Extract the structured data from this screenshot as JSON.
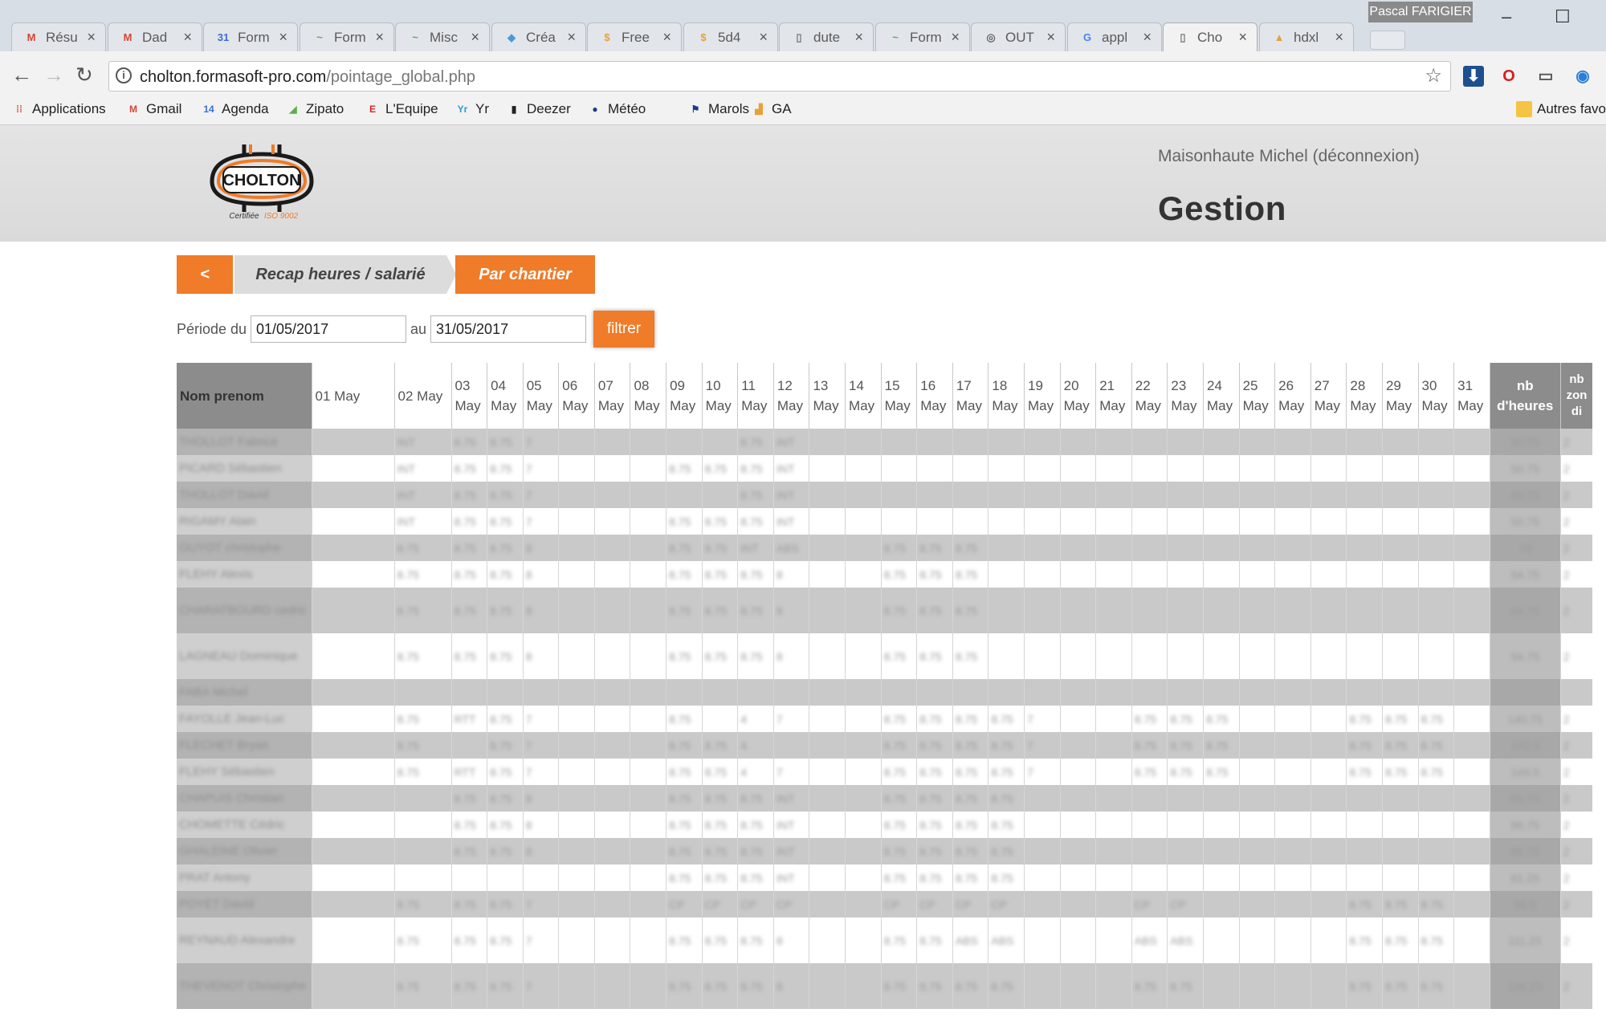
{
  "browser": {
    "profile_name": "Pascal FARIGIER",
    "tabs": [
      {
        "title": "Résu",
        "icon": "gmail-icon",
        "color": "#d44638",
        "glyph": "M",
        "active": false
      },
      {
        "title": "Dad",
        "icon": "gmail-icon",
        "color": "#d44638",
        "glyph": "M",
        "active": false
      },
      {
        "title": "Form",
        "icon": "calendar-icon",
        "color": "#3b6fd1",
        "glyph": "31",
        "active": false
      },
      {
        "title": "Form",
        "icon": "zipato-icon",
        "color": "#5ab04a",
        "glyph": "~",
        "active": false
      },
      {
        "title": "Misc",
        "icon": "zipato-icon",
        "color": "#5ab04a",
        "glyph": "~",
        "active": false
      },
      {
        "title": "Créa",
        "icon": "diamond-icon",
        "color": "#4a9ad8",
        "glyph": "◆",
        "active": false
      },
      {
        "title": "Free",
        "icon": "coin-icon",
        "color": "#e8a03a",
        "glyph": "$",
        "active": false
      },
      {
        "title": "5d4",
        "icon": "coin-icon",
        "color": "#e8a03a",
        "glyph": "$",
        "active": false
      },
      {
        "title": "dute",
        "icon": "page-icon",
        "color": "#777777",
        "glyph": "▯",
        "active": false
      },
      {
        "title": "Form",
        "icon": "zipato-icon",
        "color": "#5ab04a",
        "glyph": "~",
        "active": false
      },
      {
        "title": "OUT",
        "icon": "circle-icon",
        "color": "#666666",
        "glyph": "◎",
        "active": false
      },
      {
        "title": "appl",
        "icon": "google-icon",
        "color": "#4285f4",
        "glyph": "G",
        "active": false
      },
      {
        "title": "Cho",
        "icon": "page-icon",
        "color": "#777777",
        "glyph": "▯",
        "active": true
      },
      {
        "title": "hdxl",
        "icon": "pma-icon",
        "color": "#e8a03a",
        "glyph": "▲",
        "active": false
      }
    ],
    "url_host": "cholton.formasoft-pro.com",
    "url_path": "/pointage_global.php",
    "bookmarks": [
      {
        "label": "Applications",
        "icon": "apps-grid-icon",
        "color": "#e0533c",
        "glyph": "⁞⁞"
      },
      {
        "label": "Gmail",
        "icon": "gmail-icon",
        "color": "#d44638",
        "glyph": "M"
      },
      {
        "label": "Agenda",
        "icon": "calendar-icon",
        "color": "#3b6fd1",
        "glyph": "14"
      },
      {
        "label": "Zipato",
        "icon": "zipato-icon",
        "color": "#5ab04a",
        "glyph": "◢"
      },
      {
        "label": "L'Equipe",
        "icon": "lequipe-icon",
        "color": "#d02a2a",
        "glyph": "E"
      },
      {
        "label": "Yr",
        "icon": "yr-icon",
        "color": "#2a9ad8",
        "glyph": "Yr"
      },
      {
        "label": "Deezer",
        "icon": "deezer-icon",
        "color": "#222222",
        "glyph": "▮"
      },
      {
        "label": "Météo",
        "icon": "meteo-icon",
        "color": "#1a3a8a",
        "glyph": "●"
      },
      {
        "label": "Marols",
        "icon": "marols-icon",
        "color": "#1a3a8a",
        "glyph": "⚑"
      },
      {
        "label": "GA",
        "icon": "analytics-icon",
        "color": "#e8a03a",
        "glyph": "▟"
      }
    ],
    "other_bookmarks": "Autres favoris"
  },
  "header": {
    "logo_text": "CHOLTON",
    "logo_tagline": "Certifiée",
    "logo_iso": "ISO 9002",
    "user": "Maisonhaute Michel (déconnexion)",
    "title": "Gestion",
    "brand_color": "#f07b28"
  },
  "subnav": {
    "back": "<",
    "recap": "Recap heures / salarié",
    "chantier": "Par chantier"
  },
  "filter": {
    "label": "Période du",
    "from": "01/05/2017",
    "to_label": "au",
    "to": "31/05/2017",
    "button": "filtrer"
  },
  "table": {
    "name_header": "Nom prenom",
    "days": [
      {
        "num": "01",
        "mon": "May",
        "inline": true
      },
      {
        "num": "02",
        "mon": "May",
        "inline": true
      },
      {
        "num": "03",
        "mon": "May"
      },
      {
        "num": "04",
        "mon": "May"
      },
      {
        "num": "05",
        "mon": "May"
      },
      {
        "num": "06",
        "mon": "May"
      },
      {
        "num": "07",
        "mon": "May"
      },
      {
        "num": "08",
        "mon": "May"
      },
      {
        "num": "09",
        "mon": "May"
      },
      {
        "num": "10",
        "mon": "May"
      },
      {
        "num": "11",
        "mon": "May"
      },
      {
        "num": "12",
        "mon": "May"
      },
      {
        "num": "13",
        "mon": "May"
      },
      {
        "num": "14",
        "mon": "May"
      },
      {
        "num": "15",
        "mon": "May"
      },
      {
        "num": "16",
        "mon": "May"
      },
      {
        "num": "17",
        "mon": "May"
      },
      {
        "num": "18",
        "mon": "May"
      },
      {
        "num": "19",
        "mon": "May"
      },
      {
        "num": "20",
        "mon": "May"
      },
      {
        "num": "21",
        "mon": "May"
      },
      {
        "num": "22",
        "mon": "May"
      },
      {
        "num": "23",
        "mon": "May"
      },
      {
        "num": "24",
        "mon": "May"
      },
      {
        "num": "25",
        "mon": "May"
      },
      {
        "num": "26",
        "mon": "May"
      },
      {
        "num": "27",
        "mon": "May"
      },
      {
        "num": "28",
        "mon": "May"
      },
      {
        "num": "29",
        "mon": "May"
      },
      {
        "num": "30",
        "mon": "May"
      },
      {
        "num": "31",
        "mon": "May"
      }
    ],
    "total_header": [
      "nb",
      "d'heures"
    ],
    "extra_header": [
      "nb",
      "zon",
      "di"
    ],
    "rows": [
      {
        "name": "THOLLOT Fabrice",
        "cells": [
          "",
          "INT",
          "8.75",
          "8.75",
          "7",
          "",
          "",
          "",
          "",
          "",
          "8.75",
          "INT",
          "",
          "",
          "",
          "",
          "",
          "",
          "",
          "",
          "",
          "",
          "",
          "",
          "",
          "",
          "",
          "",
          "",
          "",
          ""
        ],
        "total": "50.75",
        "extra": "2",
        "tall": false
      },
      {
        "name": "PICARD Sébastien",
        "cells": [
          "",
          "INT",
          "8.75",
          "8.75",
          "7",
          "",
          "",
          "",
          "8.75",
          "8.75",
          "8.75",
          "INT",
          "",
          "",
          "",
          "",
          "",
          "",
          "",
          "",
          "",
          "",
          "",
          "",
          "",
          "",
          "",
          "",
          "",
          "",
          ""
        ],
        "total": "50.75",
        "extra": "2",
        "tall": false
      },
      {
        "name": "THOLLOT David",
        "cells": [
          "",
          "INT",
          "8.75",
          "8.75",
          "7",
          "",
          "",
          "",
          "",
          "",
          "8.75",
          "INT",
          "",
          "",
          "",
          "",
          "",
          "",
          "",
          "",
          "",
          "",
          "",
          "",
          "",
          "",
          "",
          "",
          "",
          "",
          ""
        ],
        "total": "50.75",
        "extra": "2",
        "tall": false
      },
      {
        "name": "RIGAMY Alain",
        "cells": [
          "",
          "INT",
          "8.75",
          "8.75",
          "7",
          "",
          "",
          "",
          "8.75",
          "8.75",
          "8.75",
          "INT",
          "",
          "",
          "",
          "",
          "",
          "",
          "",
          "",
          "",
          "",
          "",
          "",
          "",
          "",
          "",
          "",
          "",
          "",
          ""
        ],
        "total": "50.75",
        "extra": "2",
        "tall": false
      },
      {
        "name": "GUYOT christophe",
        "cells": [
          "",
          "8.75",
          "8.75",
          "8.75",
          "8",
          "",
          "",
          "",
          "8.75",
          "8.75",
          "INT",
          "ABS",
          "",
          "",
          "8.75",
          "8.75",
          "8.75",
          "",
          "",
          "",
          "",
          "",
          "",
          "",
          "",
          "",
          "",
          "",
          "",
          "",
          ""
        ],
        "total": "78",
        "extra": "2",
        "tall": false
      },
      {
        "name": "FLEHY Alexis",
        "cells": [
          "",
          "8.75",
          "8.75",
          "8.75",
          "8",
          "",
          "",
          "",
          "8.75",
          "8.75",
          "8.75",
          "8",
          "",
          "",
          "8.75",
          "8.75",
          "8.75",
          "",
          "",
          "",
          "",
          "",
          "",
          "",
          "",
          "",
          "",
          "",
          "",
          "",
          ""
        ],
        "total": "94.75",
        "extra": "2",
        "tall": false
      },
      {
        "name": "CHARATBOURD cedric",
        "cells": [
          "",
          "8.75",
          "8.75",
          "8.75",
          "8",
          "",
          "",
          "",
          "8.75",
          "8.75",
          "8.75",
          "8",
          "",
          "",
          "8.75",
          "8.75",
          "8.75",
          "",
          "",
          "",
          "",
          "",
          "",
          "",
          "",
          "",
          "",
          "",
          "",
          "",
          ""
        ],
        "total": "94.75",
        "extra": "2",
        "tall": true
      },
      {
        "name": "LAGNEAU Dominique",
        "cells": [
          "",
          "8.75",
          "8.75",
          "8.75",
          "8",
          "",
          "",
          "",
          "8.75",
          "8.75",
          "8.75",
          "8",
          "",
          "",
          "8.75",
          "8.75",
          "8.75",
          "",
          "",
          "",
          "",
          "",
          "",
          "",
          "",
          "",
          "",
          "",
          "",
          "",
          ""
        ],
        "total": "94.75",
        "extra": "2",
        "tall": true
      },
      {
        "name": "FABA Michel",
        "cells": [
          "",
          "",
          "",
          "",
          "",
          "",
          "",
          "",
          "",
          "",
          "",
          "",
          "",
          "",
          "",
          "",
          "",
          "",
          "",
          "",
          "",
          "",
          "",
          "",
          "",
          "",
          "",
          "",
          "",
          "",
          ""
        ],
        "total": "",
        "extra": "",
        "tall": false
      },
      {
        "name": "FAYOLLE Jean-Luc",
        "cells": [
          "",
          "8.75",
          "RTT",
          "8.75",
          "7",
          "",
          "",
          "",
          "8.75",
          "",
          "4",
          "7",
          "",
          "",
          "8.75",
          "8.75",
          "8.75",
          "8.75",
          "7",
          "",
          "",
          "8.75",
          "8.75",
          "8.75",
          "",
          "",
          "",
          "8.75",
          "8.75",
          "8.75",
          ""
        ],
        "total": "140.75",
        "extra": "2",
        "tall": false
      },
      {
        "name": "FLECHET Bryan",
        "cells": [
          "",
          "8.75",
          "",
          "8.75",
          "7",
          "",
          "",
          "",
          "8.75",
          "8.75",
          "4",
          "",
          "",
          "",
          "8.75",
          "8.75",
          "8.75",
          "8.75",
          "7",
          "",
          "",
          "8.75",
          "8.75",
          "8.75",
          "",
          "",
          "",
          "8.75",
          "8.75",
          "8.75",
          ""
        ],
        "total": "142.5",
        "extra": "2",
        "tall": false
      },
      {
        "name": "FLEHY Sébastien",
        "cells": [
          "",
          "8.75",
          "RTT",
          "8.75",
          "7",
          "",
          "",
          "",
          "8.75",
          "8.75",
          "4",
          "7",
          "",
          "",
          "8.75",
          "8.75",
          "8.75",
          "8.75",
          "7",
          "",
          "",
          "8.75",
          "8.75",
          "8.75",
          "",
          "",
          "",
          "8.75",
          "8.75",
          "8.75",
          ""
        ],
        "total": "149.5",
        "extra": "2",
        "tall": false
      },
      {
        "name": "CHAPUIS Christian",
        "cells": [
          "",
          "",
          "8.75",
          "8.75",
          "8",
          "",
          "",
          "",
          "8.75",
          "8.75",
          "8.75",
          "INT",
          "",
          "",
          "8.75",
          "8.75",
          "8.75",
          "8.75",
          "",
          "",
          "",
          "",
          "",
          "",
          "",
          "",
          "",
          "",
          "",
          "",
          ""
        ],
        "total": "86.75",
        "extra": "2",
        "tall": false
      },
      {
        "name": "CHOMETTE Cédric",
        "cells": [
          "",
          "",
          "8.75",
          "8.75",
          "8",
          "",
          "",
          "",
          "8.75",
          "8.75",
          "8.75",
          "INT",
          "",
          "",
          "8.75",
          "8.75",
          "8.75",
          "8.75",
          "",
          "",
          "",
          "",
          "",
          "",
          "",
          "",
          "",
          "",
          "",
          "",
          ""
        ],
        "total": "86.75",
        "extra": "2",
        "tall": false
      },
      {
        "name": "GHALEINE Olivier",
        "cells": [
          "",
          "",
          "8.75",
          "8.75",
          "8",
          "",
          "",
          "",
          "8.75",
          "8.75",
          "8.75",
          "INT",
          "",
          "",
          "8.75",
          "8.75",
          "8.75",
          "8.75",
          "",
          "",
          "",
          "",
          "",
          "",
          "",
          "",
          "",
          "",
          "",
          "",
          ""
        ],
        "total": "86.75",
        "extra": "2",
        "tall": false
      },
      {
        "name": "PRAT Antony",
        "cells": [
          "",
          "",
          "",
          "",
          "",
          "",
          "",
          "",
          "8.75",
          "8.75",
          "8.75",
          "INT",
          "",
          "",
          "8.75",
          "8.75",
          "8.75",
          "8.75",
          "",
          "",
          "",
          "",
          "",
          "",
          "",
          "",
          "",
          "",
          "",
          "",
          ""
        ],
        "total": "61.25",
        "extra": "2",
        "tall": false
      },
      {
        "name": "POYET David",
        "cells": [
          "",
          "8.75",
          "8.75",
          "8.75",
          "7",
          "",
          "",
          "",
          "CP",
          "CP",
          "CP",
          "CP",
          "",
          "",
          "CP",
          "CP",
          "CP",
          "CP",
          "",
          "",
          "",
          "CP",
          "CP",
          "",
          "",
          "",
          "",
          "8.75",
          "8.75",
          "8.75",
          ""
        ],
        "total": "58.5",
        "extra": "2",
        "tall": false
      },
      {
        "name": "REYNAUD Alexandre",
        "cells": [
          "",
          "8.75",
          "8.75",
          "8.75",
          "7",
          "",
          "",
          "",
          "8.75",
          "8.75",
          "8.75",
          "8",
          "",
          "",
          "8.75",
          "8.75",
          "ABS",
          "ABS",
          "",
          "",
          "",
          "ABS",
          "ABS",
          "",
          "",
          "",
          "",
          "8.75",
          "8.75",
          "8.75",
          ""
        ],
        "total": "111.25",
        "extra": "2",
        "tall": true
      },
      {
        "name": "THEVENOT Christophe",
        "cells": [
          "",
          "8.75",
          "8.75",
          "8.75",
          "7",
          "",
          "",
          "",
          "8.75",
          "8.75",
          "8.75",
          "8",
          "",
          "",
          "8.75",
          "8.75",
          "8.75",
          "8.75",
          "",
          "",
          "",
          "8.75",
          "8.75",
          "",
          "",
          "",
          "",
          "8.75",
          "8.75",
          "8.75",
          ""
        ],
        "total": "146.25",
        "extra": "2",
        "tall": true
      }
    ]
  }
}
